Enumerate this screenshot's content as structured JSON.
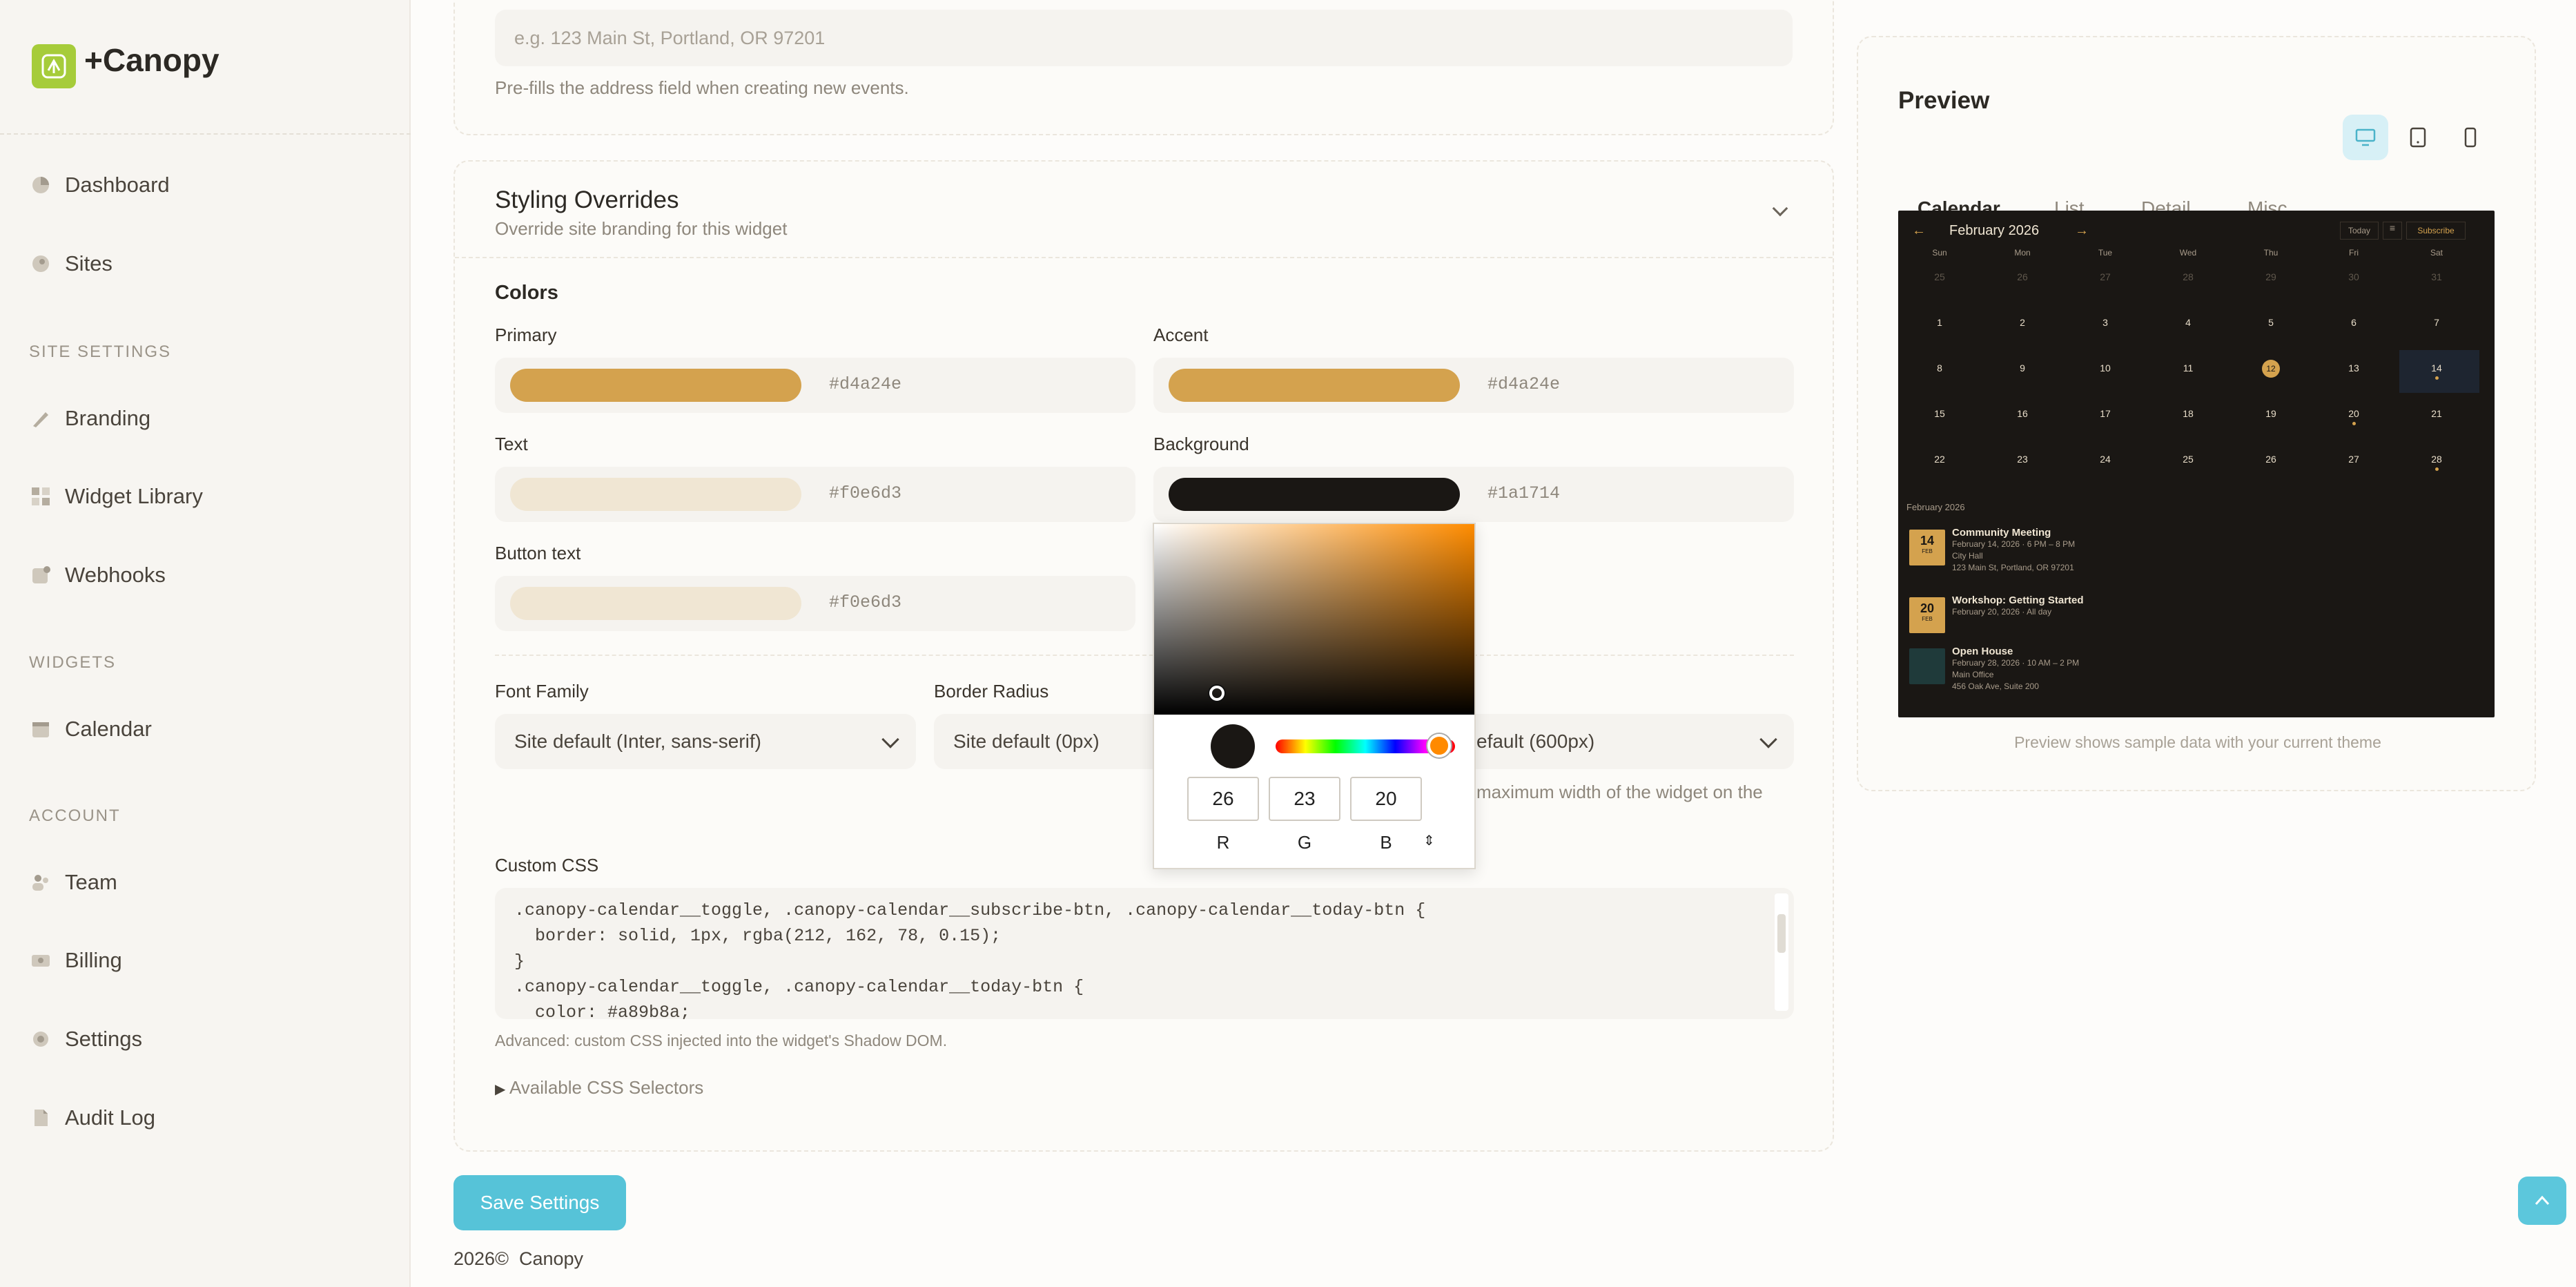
{
  "brand": {
    "name": "+Canopy",
    "accent": "#a6cc3a"
  },
  "nav": {
    "dashboard": "Dashboard",
    "sites": "Sites",
    "section_site": "SITE SETTINGS",
    "branding": "Branding",
    "widget_library": "Widget Library",
    "webhooks": "Webhooks",
    "section_widgets": "WIDGETS",
    "calendar": "Calendar",
    "section_account": "ACCOUNT",
    "team": "Team",
    "billing": "Billing",
    "settings": "Settings",
    "audit_log": "Audit Log"
  },
  "address": {
    "placeholder": "e.g. 123 Main St, Portland, OR 97201",
    "help": "Pre-fills the address field when creating new events."
  },
  "styling": {
    "title": "Styling Overrides",
    "subtitle": "Override site branding for this widget",
    "colors_heading": "Colors",
    "primary": {
      "label": "Primary",
      "value": "#d4a24e"
    },
    "accent": {
      "label": "Accent",
      "value": "#d4a24e"
    },
    "text": {
      "label": "Text",
      "value": "#f0e6d3"
    },
    "background": {
      "label": "Background",
      "value": "#1a1714"
    },
    "button_text": {
      "label": "Button text",
      "value": "#f0e6d3"
    },
    "font_family": {
      "label": "Font Family",
      "value": "Site default (Inter, sans-serif)"
    },
    "border_radius": {
      "label": "Border Radius",
      "value": "Site default (0px)"
    },
    "max_width": {
      "value": "efault (600px)",
      "help": "maximum width of the widget on the"
    },
    "custom_css": {
      "label": "Custom CSS",
      "lines": [
        ".canopy-calendar__toggle, .canopy-calendar__subscribe-btn, .canopy-calendar__today-btn {",
        "  border: solid, 1px, rgba(212, 162, 78, 0.15);",
        "}",
        ".canopy-calendar__toggle, .canopy-calendar__today-btn {",
        "  color: #a89b8a;"
      ],
      "help": "Advanced: custom CSS injected into the widget's Shadow DOM."
    },
    "selectors": "Available CSS Selectors"
  },
  "picker": {
    "r": "26",
    "g": "23",
    "b": "20",
    "r_label": "R",
    "g_label": "G",
    "b_label": "B"
  },
  "save": "Save Settings",
  "footer": {
    "year": "2026©",
    "name": "Canopy"
  },
  "preview": {
    "title": "Preview",
    "tabs": [
      "Calendar",
      "List",
      "Detail",
      "Misc"
    ],
    "note": "Preview shows sample data with your current theme",
    "calendar": {
      "month": "February 2026",
      "today": "Today",
      "subscribe": "Subscribe",
      "weekdays": [
        "Sun",
        "Mon",
        "Tue",
        "Wed",
        "Thu",
        "Fri",
        "Sat"
      ],
      "weeks": [
        [
          "25",
          "26",
          "27",
          "28",
          "29",
          "30",
          "31"
        ],
        [
          "1",
          "2",
          "3",
          "4",
          "5",
          "6",
          "7"
        ],
        [
          "8",
          "9",
          "10",
          "11",
          "12",
          "13",
          "14"
        ],
        [
          "15",
          "16",
          "17",
          "18",
          "19",
          "20",
          "21"
        ],
        [
          "22",
          "23",
          "24",
          "25",
          "26",
          "27",
          "28"
        ]
      ],
      "list_month": "February 2026",
      "events": [
        {
          "day": "14",
          "mon": "FEB",
          "title": "Community Meeting",
          "date": "February 14, 2026 · 6 PM – 8 PM",
          "loc": "City Hall",
          "addr": "123 Main St, Portland, OR 97201"
        },
        {
          "day": "20",
          "mon": "FEB",
          "title": "Workshop: Getting Started",
          "date": "February 20, 2026 · All day",
          "loc": "",
          "addr": ""
        },
        {
          "day": "",
          "mon": "",
          "title": "Open House",
          "date": "February 28, 2026 · 10 AM – 2 PM",
          "loc": "Main Office",
          "addr": "456 Oak Ave, Suite 200"
        }
      ]
    }
  }
}
